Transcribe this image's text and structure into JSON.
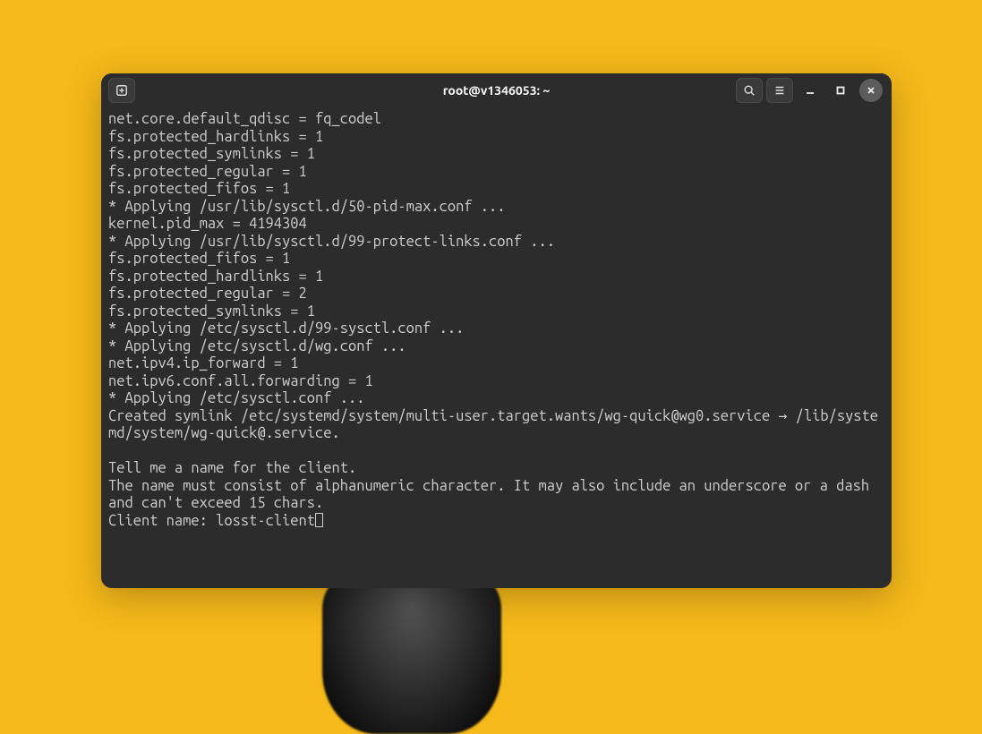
{
  "window": {
    "title": "root@v1346053: ~"
  },
  "icons": {
    "new_tab": "new-tab-icon",
    "search": "search-icon",
    "menu": "menu-icon",
    "minimize": "minimize-icon",
    "maximize": "maximize-icon",
    "close": "close-icon"
  },
  "terminal": {
    "lines": [
      "net.core.default_qdisc = fq_codel",
      "fs.protected_hardlinks = 1",
      "fs.protected_symlinks = 1",
      "fs.protected_regular = 1",
      "fs.protected_fifos = 1",
      "* Applying /usr/lib/sysctl.d/50-pid-max.conf ...",
      "kernel.pid_max = 4194304",
      "* Applying /usr/lib/sysctl.d/99-protect-links.conf ...",
      "fs.protected_fifos = 1",
      "fs.protected_hardlinks = 1",
      "fs.protected_regular = 2",
      "fs.protected_symlinks = 1",
      "* Applying /etc/sysctl.d/99-sysctl.conf ...",
      "* Applying /etc/sysctl.d/wg.conf ...",
      "net.ipv4.ip_forward = 1",
      "net.ipv6.conf.all.forwarding = 1",
      "* Applying /etc/sysctl.conf ...",
      "Created symlink /etc/systemd/system/multi-user.target.wants/wg-quick@wg0.service → /lib/systemd/system/wg-quick@.service.",
      "",
      "Tell me a name for the client.",
      "The name must consist of alphanumeric character. It may also include an underscore or a dash and can't exceed 15 chars."
    ],
    "prompt_label": "Client name: ",
    "prompt_input": "losst-client"
  }
}
